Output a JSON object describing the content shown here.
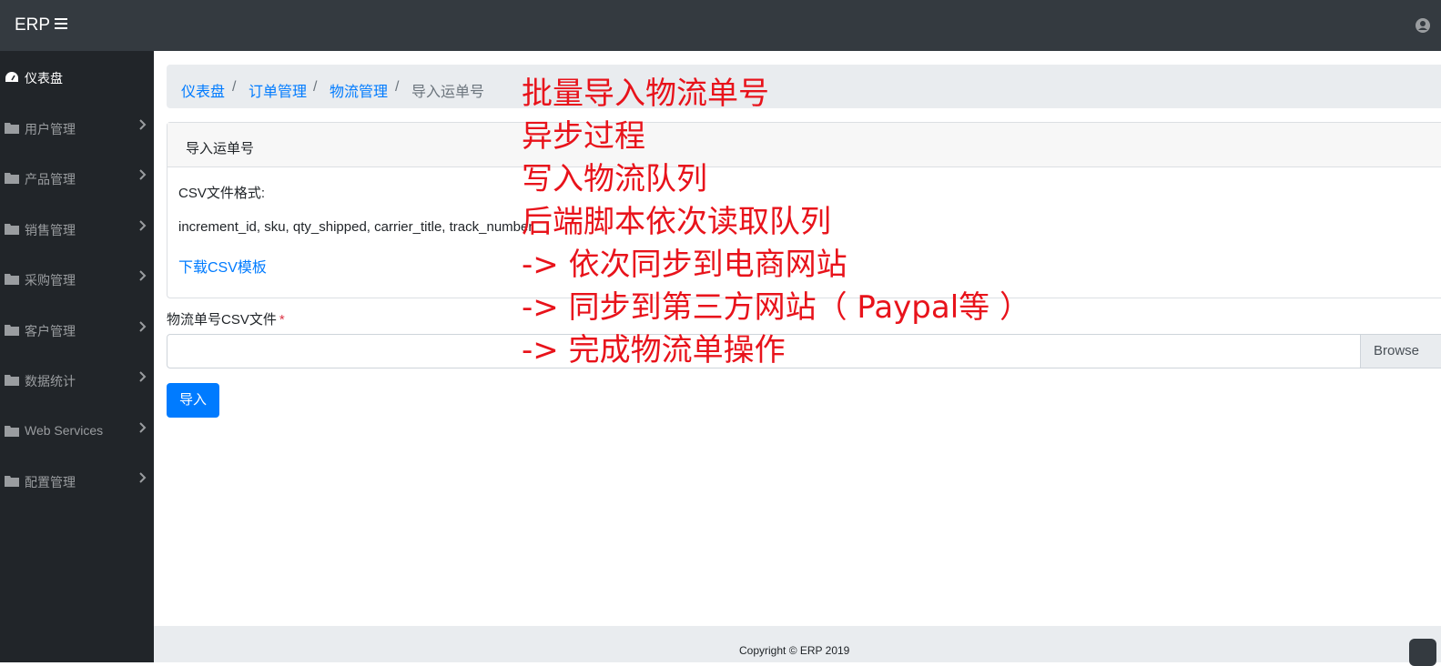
{
  "navbar": {
    "brand": "ERP"
  },
  "sidebar": {
    "items": [
      {
        "label": "仪表盘",
        "active": true
      },
      {
        "label": "用户管理"
      },
      {
        "label": "产品管理"
      },
      {
        "label": "销售管理"
      },
      {
        "label": "采购管理"
      },
      {
        "label": "客户管理"
      },
      {
        "label": "数据统计"
      },
      {
        "label": "Web Services"
      },
      {
        "label": "配置管理"
      }
    ]
  },
  "breadcrumb": {
    "items": [
      "仪表盘",
      "订单管理",
      "物流管理",
      "导入运单号"
    ],
    "separator": "/"
  },
  "card": {
    "title": "导入运单号",
    "format_label": "CSV文件格式:",
    "format_columns": "increment_id, sku, qty_shipped, carrier_title, track_number",
    "download_link": "下载CSV模板"
  },
  "form": {
    "file_label": "物流单号CSV文件",
    "required_mark": "*",
    "browse_label": "Browse",
    "submit_label": "导入"
  },
  "footer": {
    "copyright": "Copyright © ERP 2019"
  },
  "annotations": [
    "批量导入物流单号",
    "异步过程",
    "写入物流队列",
    "后端脚本依次读取队列",
    "-> 依次同步到电商网站",
    "-> 同步到第三方网站（ Paypal等 ）",
    "-> 完成物流单操作"
  ],
  "colors": {
    "navbar": "#343a40",
    "sidebar": "#212529",
    "link": "#007bff",
    "annotation": "#e8131b"
  }
}
